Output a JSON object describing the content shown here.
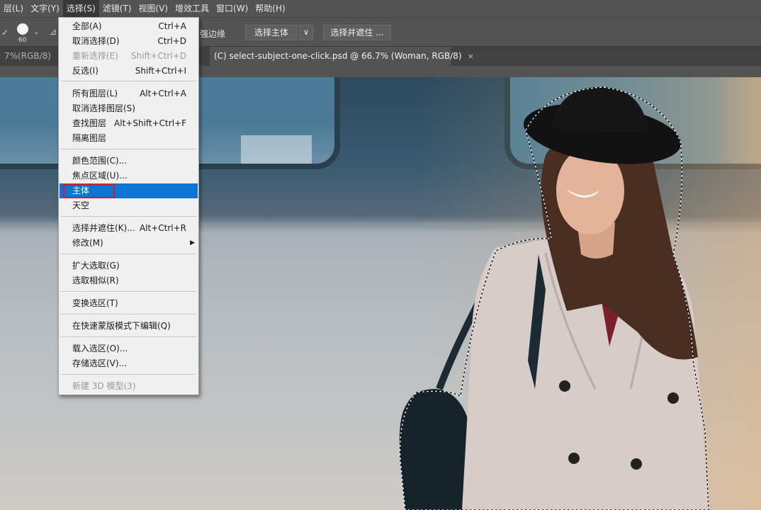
{
  "menubar": {
    "items": [
      "层(L)",
      "文字(Y)",
      "选择(S)",
      "滤镜(T)",
      "视图(V)",
      "增效工具",
      "窗口(W)",
      "帮助(H)"
    ]
  },
  "options": {
    "brush_size": "60",
    "enhance_edge": "强边缘",
    "select_subject": "选择主体",
    "select_and_mask": "选择并遮住 ...",
    "dropdown_glyph": "∨"
  },
  "tabs": [
    {
      "label": "7%(RGB/8)",
      "close": "×"
    },
    {
      "label": "(C) select-subject-one-click.psd @ 66.7% (Woman, RGB/8)",
      "close": "×"
    }
  ],
  "menu": {
    "items": [
      {
        "label": "全部(A)",
        "shortcut": "Ctrl+A"
      },
      {
        "label": "取消选择(D)",
        "shortcut": "Ctrl+D"
      },
      {
        "label": "重新选择(E)",
        "shortcut": "Shift+Ctrl+D",
        "disabled": true
      },
      {
        "label": "反选(I)",
        "shortcut": "Shift+Ctrl+I"
      },
      {
        "label": "所有图层(L)",
        "shortcut": "Alt+Ctrl+A"
      },
      {
        "label": "取消选择图层(S)",
        "shortcut": ""
      },
      {
        "label": "查找图层",
        "shortcut": "Alt+Shift+Ctrl+F"
      },
      {
        "label": "隔离图层",
        "shortcut": ""
      },
      {
        "label": "颜色范围(C)...",
        "shortcut": ""
      },
      {
        "label": "焦点区域(U)...",
        "shortcut": ""
      },
      {
        "label": "主体",
        "shortcut": "",
        "highlighted": true
      },
      {
        "label": "天空",
        "shortcut": ""
      },
      {
        "label": "选择并遮住(K)...",
        "shortcut": "Alt+Ctrl+R"
      },
      {
        "label": "修改(M)",
        "shortcut": "",
        "submenu": true
      },
      {
        "label": "扩大选取(G)",
        "shortcut": ""
      },
      {
        "label": "选取相似(R)",
        "shortcut": ""
      },
      {
        "label": "变换选区(T)",
        "shortcut": ""
      },
      {
        "label": "在快速蒙版模式下编辑(Q)",
        "shortcut": ""
      },
      {
        "label": "载入选区(O)...",
        "shortcut": ""
      },
      {
        "label": "存储选区(V)...",
        "shortcut": ""
      },
      {
        "label": "新建 3D 模型(3)",
        "shortcut": "",
        "disabled": true
      }
    ],
    "submenu_arrow": "▶"
  },
  "colors": {
    "highlight": "#0c74d4",
    "annotation_box": "#e0181f",
    "menu_background": "#f0f0f0",
    "chrome": "#535353"
  }
}
